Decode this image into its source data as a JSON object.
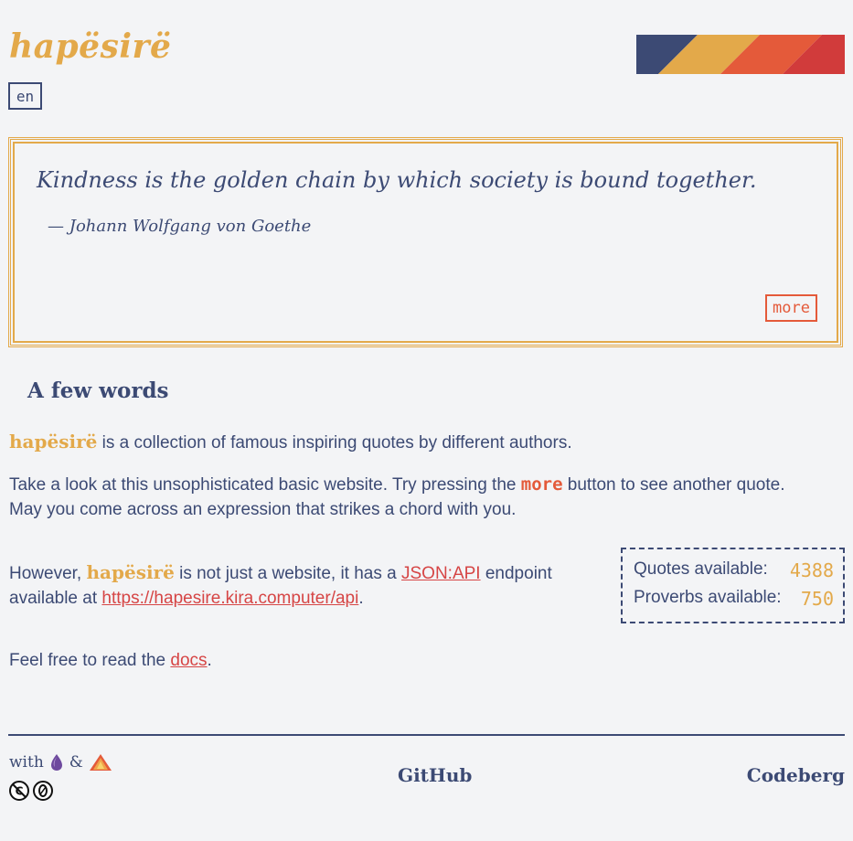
{
  "header": {
    "logo": "hapësirë",
    "language": "en"
  },
  "quote": {
    "text": "Kindness is the golden chain by which society is bound together.",
    "author": "— Johann Wolfgang von Goethe",
    "more_label": "more"
  },
  "about": {
    "title": "A few words",
    "brand": "hapësirë",
    "p1_rest": " is a collection of famous inspiring quotes by different authors.",
    "p2_before": "Take a look at this unsophisticated basic website. Try pressing the ",
    "p2_more": "more",
    "p2_after": " button to see another quote.",
    "p2_line2": "May you come across an expression that strikes a chord with you.",
    "p3_before": "However, ",
    "p3_mid": " is not just a website, it has a ",
    "p3_link": "JSON:API",
    "p3_after": " endpoint",
    "p3_line2_before": "available at ",
    "p3_url": "https://hapesire.kira.computer/api",
    "p3_end": ".",
    "p4_before": "Feel free to read the ",
    "p4_link": "docs",
    "p4_end": "."
  },
  "stats": {
    "quotes_label": "Quotes available:",
    "quotes_value": "4388",
    "proverbs_label": "Proverbs available:",
    "proverbs_value": "750"
  },
  "footer": {
    "with_label": "with",
    "amp": "&",
    "github": "GitHub",
    "codeberg": "Codeberg"
  },
  "colors": {
    "navy": "#3c4a74",
    "gold": "#e3a94a",
    "orange": "#e45a3a",
    "red": "#d64545"
  }
}
